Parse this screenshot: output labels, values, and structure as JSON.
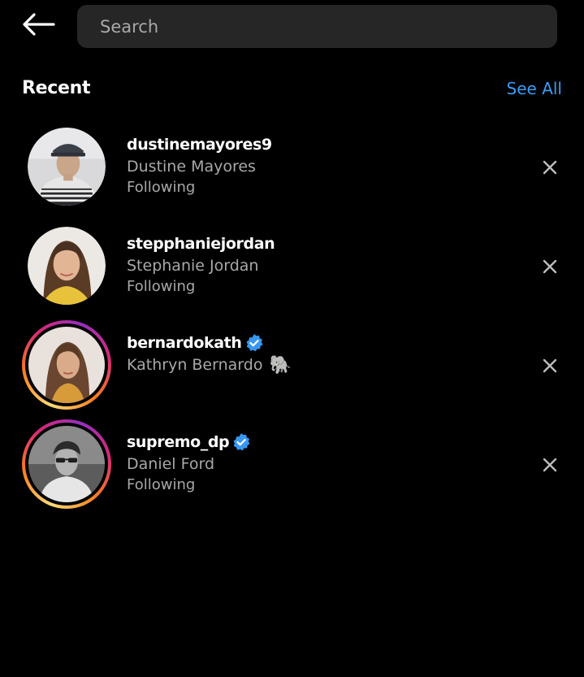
{
  "header": {
    "back_icon": "arrow-left-icon",
    "search_placeholder": "Search"
  },
  "recent": {
    "title": "Recent",
    "see_all_label": "See All"
  },
  "accounts": [
    {
      "username": "dustinemayores9",
      "full_name": "Dustine Mayores",
      "status": "Following",
      "verified": false,
      "story_ring": false
    },
    {
      "username": "stepphaniejordan",
      "full_name": "Stephanie Jordan",
      "status": "Following",
      "verified": false,
      "story_ring": false
    },
    {
      "username": "bernardokath",
      "full_name": "Kathryn Bernardo",
      "emoji": "🐘",
      "verified": true,
      "story_ring": true
    },
    {
      "username": "supremo_dp",
      "full_name": "Daniel Ford",
      "status": "Following",
      "verified": true,
      "story_ring": true
    }
  ],
  "colors": {
    "background": "#000000",
    "search_bg": "#262626",
    "link_blue": "#3b9cf2",
    "secondary_text": "#a8a8a8",
    "verified_blue": "#3897f0"
  }
}
